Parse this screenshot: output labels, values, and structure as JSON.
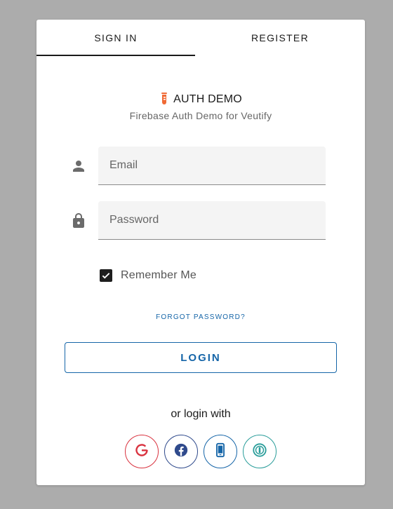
{
  "tabs": {
    "signin_label": "SIGN IN",
    "register_label": "REGISTER",
    "active": "SIGN IN"
  },
  "brand": {
    "title": "AUTH DEMO",
    "subtitle": "Firebase Auth Demo for Veutify",
    "icon": "flask-icon"
  },
  "form": {
    "email": {
      "placeholder": "Email",
      "value": "",
      "icon": "person-icon"
    },
    "password": {
      "placeholder": "Password",
      "value": "",
      "icon": "lock-icon"
    },
    "remember": {
      "label": "Remember Me",
      "checked": true
    },
    "forgot_label": "FORGOT PASSWORD?",
    "login_label": "LOGIN"
  },
  "social": {
    "heading": "or login with",
    "providers": [
      {
        "name": "google",
        "icon": "google-icon",
        "color": "#d9323f"
      },
      {
        "name": "facebook",
        "icon": "facebook-icon",
        "color": "#2f4a8c"
      },
      {
        "name": "phone",
        "icon": "phone-icon",
        "color": "#1565a8"
      },
      {
        "name": "other",
        "icon": "info-circle-icon",
        "color": "#2a9d9a"
      }
    ]
  },
  "colors": {
    "background": "#acacac",
    "accent": "#1565a8",
    "brand_icon": "#f06a35"
  }
}
